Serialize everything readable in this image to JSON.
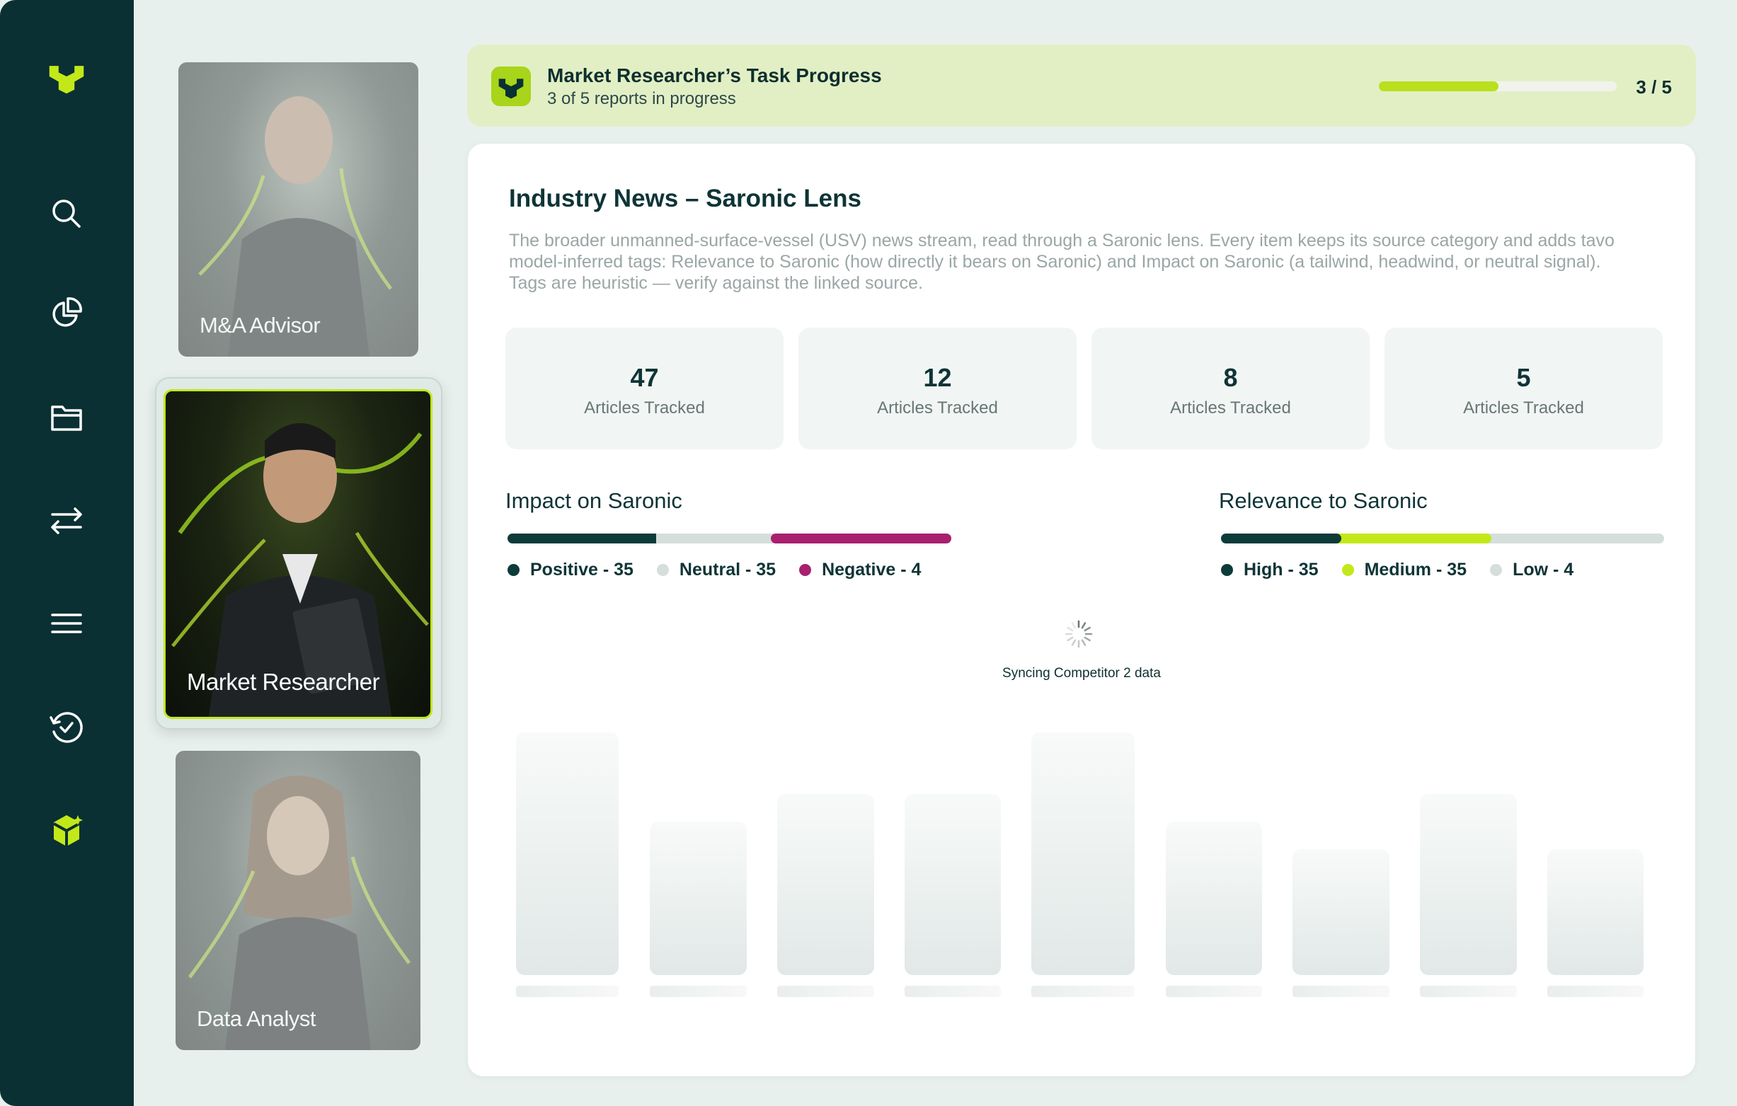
{
  "sidebar": {
    "icons": [
      "brand-logo-icon",
      "search-icon",
      "pie-chart-icon",
      "folder-icon",
      "transfer-icon",
      "menu-icon",
      "history-check-icon",
      "ai-cube-icon"
    ]
  },
  "personas": [
    {
      "label": "M&A Advisor",
      "selected": false
    },
    {
      "label": "Market Researcher",
      "selected": true
    },
    {
      "label": "Data Analyst",
      "selected": false
    }
  ],
  "progress": {
    "title": "Market Researcher’s Task Progress",
    "subtitle": "3 of 5 reports in progress",
    "count": "3 / 5",
    "fraction": 0.6
  },
  "main": {
    "title": "Industry News – Saronic Lens",
    "description": "The broader unmanned-surface-vessel (USV) news stream, read through a Saronic lens. Every item keeps its source category and adds tavo model-inferred tags: Relevance to Saronic (how directly it bears on Saronic) and Impact on Saronic (a tailwind, headwind, or neutral signal). Tags are heuristic — verify against the linked source.",
    "stats": [
      {
        "value": "47",
        "label": "Articles Tracked"
      },
      {
        "value": "12",
        "label": "Articles Tracked"
      },
      {
        "value": "8",
        "label": "Articles Tracked"
      },
      {
        "value": "5",
        "label": "Articles Tracked"
      }
    ],
    "impact": {
      "title": "Impact on Saronic",
      "legend": [
        "Positive - 35",
        "Neutral - 35",
        "Negative - 4"
      ]
    },
    "relevance": {
      "title": "Relevance to Saronic",
      "legend": [
        "High - 35",
        "Medium - 35",
        "Low - 4"
      ]
    },
    "sync_text": "Syncing Competitor 2 data"
  },
  "colors": {
    "sidebar": "#0a3033",
    "accent": "#b9e01e",
    "positive": "#0d3b3a",
    "neutral": "#d5dedb",
    "negative": "#a8206e",
    "high": "#0d3b3a",
    "medium": "#c3e81a",
    "low": "#d5dedb"
  }
}
